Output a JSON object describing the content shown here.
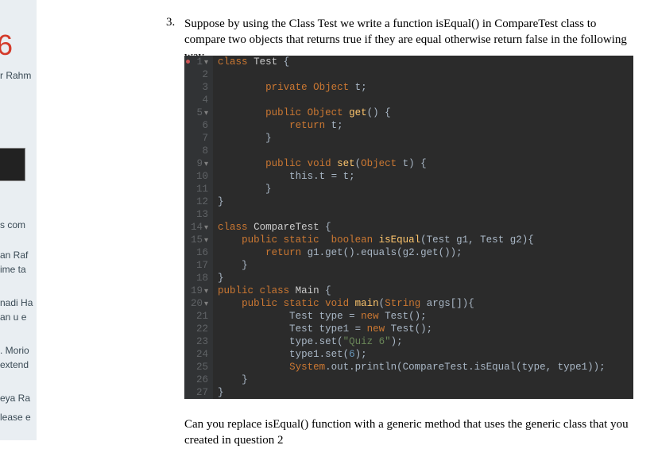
{
  "left": {
    "bigNum": "6",
    "name0": "r Rahm",
    "i1": "s com",
    "i2": "an Raf",
    "i3": "ime ta",
    "i4": "nadi Ha",
    "i5": "an u e",
    "i6": ". Morio",
    "i7": "extend",
    "i8": "eya Ra",
    "i9": "lease e"
  },
  "question": {
    "num": "3.",
    "text": "Suppose by using the Class Test we write a function isEqual() in CompareTest class to compare two objects that returns true if they are equal otherwise return false in the following way.",
    "below": "Can you replace isEqual() function with a generic method that uses the generic class that you created in question 2"
  },
  "ln": {
    "l1": "1",
    "l2": "2",
    "l3": "3",
    "l4": "4",
    "l5": "5",
    "l6": "6",
    "l7": "7",
    "l8": "8",
    "l9": "9",
    "l10": "10",
    "l11": "11",
    "l12": "12",
    "l13": "13",
    "l14": "14",
    "l15": "15",
    "l16": "16",
    "l17": "17",
    "l18": "18",
    "l19": "19",
    "l20": "20",
    "l21": "21",
    "l22": "22",
    "l23": "23",
    "l24": "24",
    "l25": "25",
    "l26": "26",
    "l27": "27"
  },
  "tok": {
    "class": "class",
    "Test": "Test",
    "lbrace": " {",
    "private": "private",
    "Object": "Object",
    "t_field": " t;",
    "public": "public",
    "get": "get",
    "noargs": "() {",
    "return": "return",
    "t_semi": " t;",
    "rbrace": "}",
    "void": "void",
    "set": "set",
    "lparen": "(",
    "Obj_t": " t) {",
    "this_t": "            this.t = t;",
    "rbrace_sp": "        }",
    "rbrace_top": "}",
    "CompareTest": "CompareTest",
    "static": "static",
    "boolean": "boolean",
    "isEqual": "isEqual",
    "params": "(Test g1, Test g2){",
    "ret_eq": " g1.get().equals(g2.get());",
    "Main": "Main",
    "main": "main",
    "String": "String",
    "args": " args[]){",
    "new": "new",
    "line21a": "            Test type = ",
    "line21b": " Test();",
    "line22a": "            Test type1 = ",
    "line22b": " Test();",
    "line23a": "            type.set(",
    "str_quiz": "\"Quiz 6\"",
    "line23b": ");",
    "line24a": "            type1.set(",
    "six": "6",
    "line24b": ");",
    "System": "System",
    "line25b": ".out.println(CompareTest.isEqual(type, type1));"
  }
}
